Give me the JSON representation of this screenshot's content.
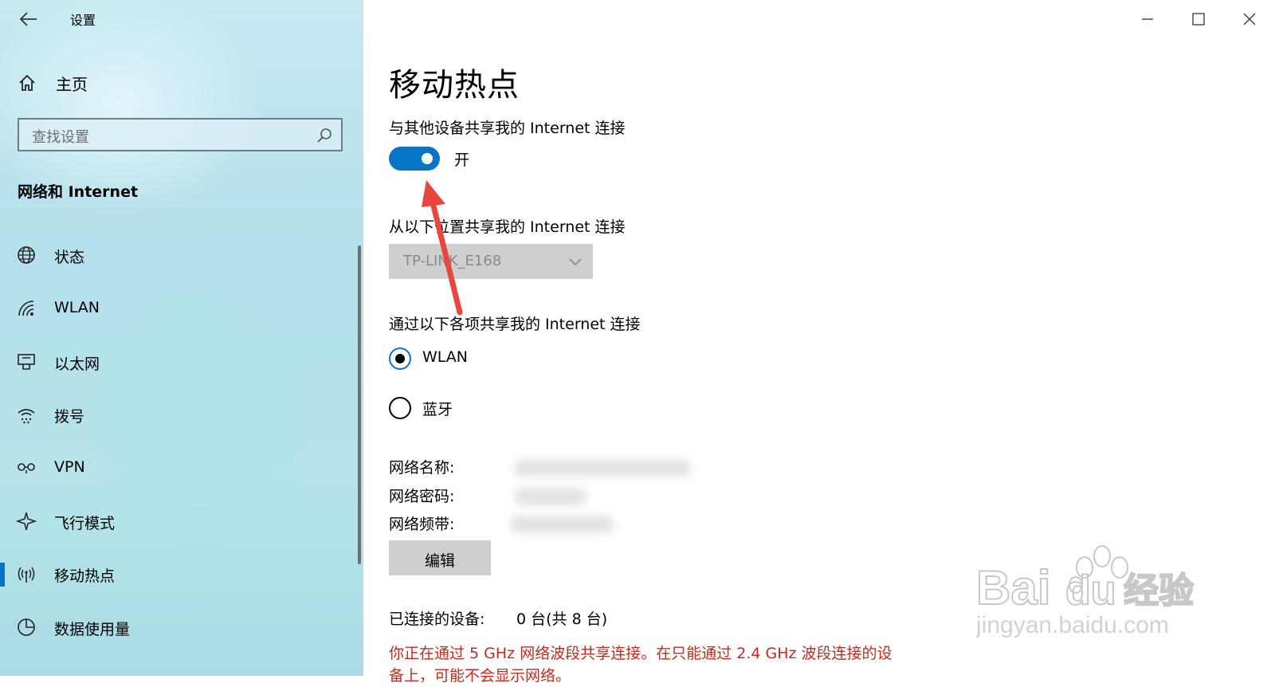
{
  "window": {
    "title": "设置",
    "controls": [
      "minimize-icon",
      "maximize-icon",
      "close-icon"
    ]
  },
  "sidebar": {
    "home_label": "主页",
    "search_placeholder": "查找设置",
    "section_title": "网络和 Internet",
    "items": [
      {
        "label": "状态",
        "icon": "globe-icon"
      },
      {
        "label": "WLAN",
        "icon": "wifi-icon"
      },
      {
        "label": "以太网",
        "icon": "ethernet-icon"
      },
      {
        "label": "拨号",
        "icon": "dialup-icon"
      },
      {
        "label": "VPN",
        "icon": "vpn-icon"
      },
      {
        "label": "飞行模式",
        "icon": "airplane-icon"
      },
      {
        "label": "移动热点",
        "icon": "hotspot-icon",
        "active": true
      },
      {
        "label": "数据使用量",
        "icon": "data-usage-icon"
      }
    ]
  },
  "main": {
    "title": "移动热点",
    "share_label": "与其他设备共享我的 Internet 连接",
    "toggle_on": true,
    "toggle_state": "开",
    "from_label": "从以下位置共享我的 Internet 连接",
    "from_value": "TP-LINK_E168",
    "via_label": "通过以下各项共享我的 Internet 连接",
    "options": [
      {
        "label": "WLAN",
        "selected": true
      },
      {
        "label": "蓝牙",
        "selected": false
      }
    ],
    "network_name_label": "网络名称:",
    "network_password_label": "网络密码:",
    "network_band_label": "网络频带:",
    "edit_button": "编辑",
    "connected_label": "已连接的设备:",
    "connected_value": "0 台(共 8 台)",
    "warning": "你正在通过 5 GHz 网络波段共享连接。在只能通过 2.4 GHz 波段连接的设备上，可能不会显示网络。"
  },
  "accent_color": "#0a74c4",
  "warning_color": "#c42b1c",
  "annotation_arrow_color": "#e8473e",
  "watermark": "Baidu经验 jingyan.baidu.com"
}
